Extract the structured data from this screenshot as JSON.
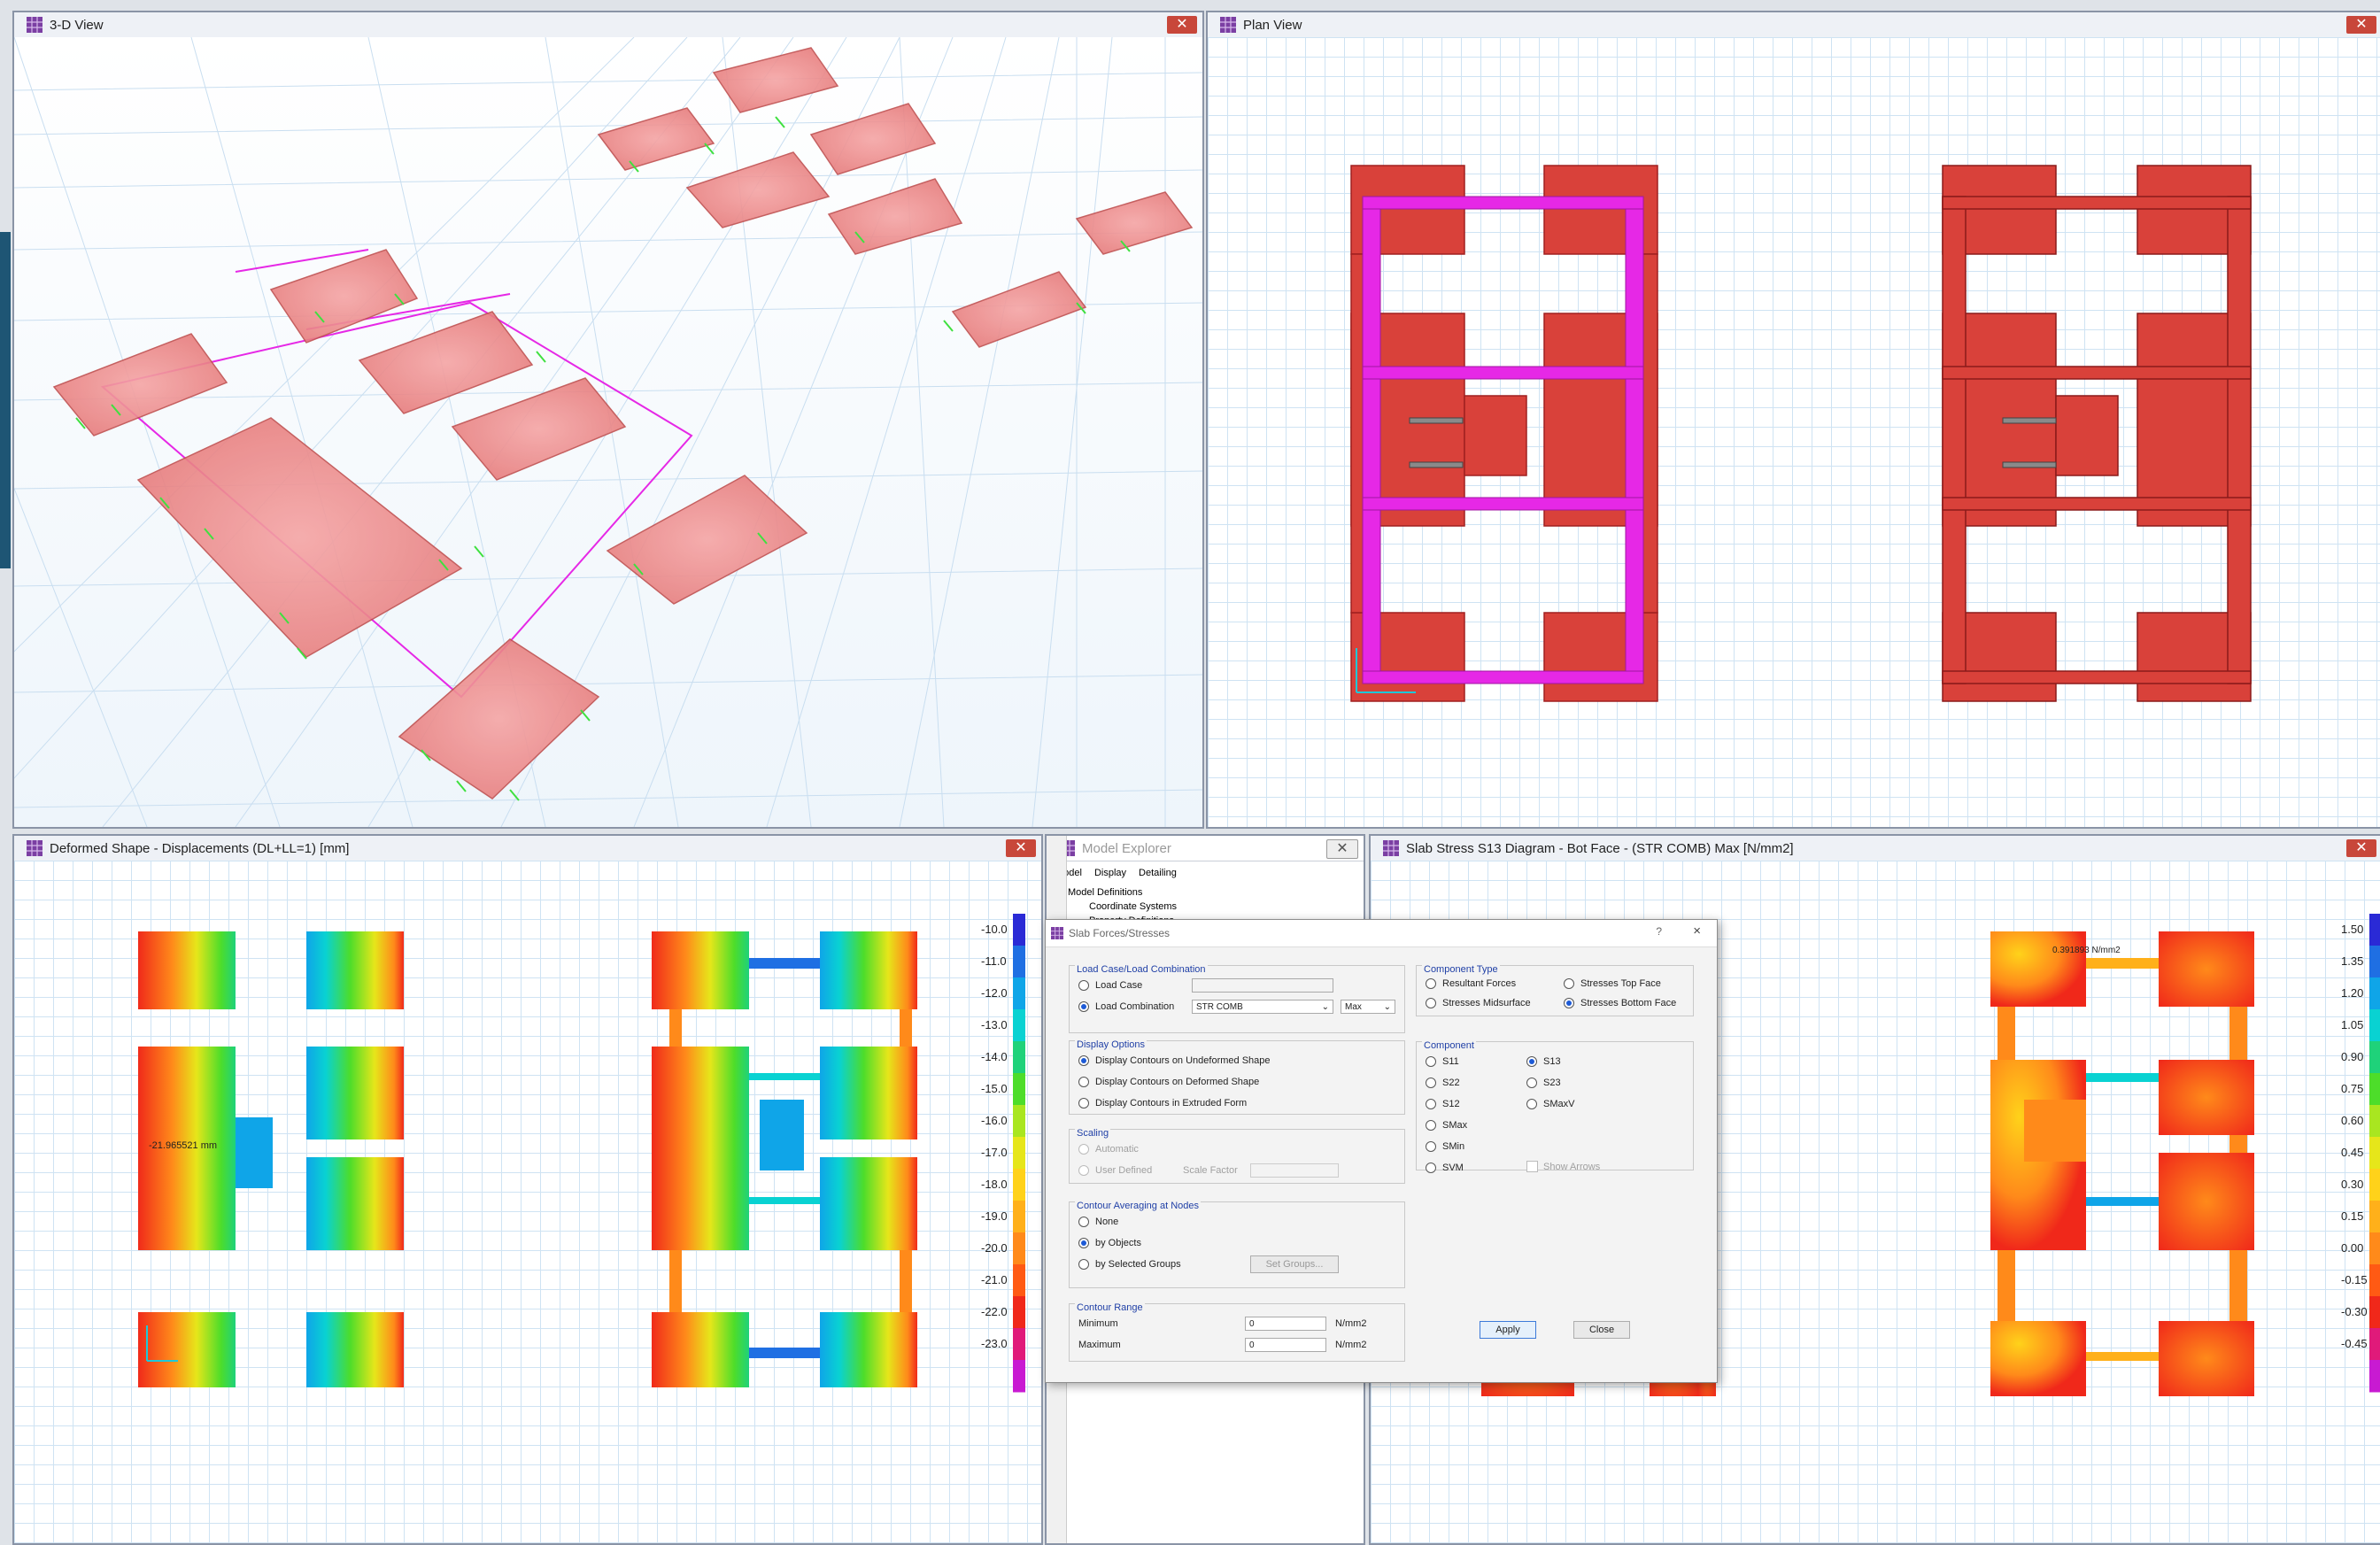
{
  "windows": {
    "view3d": {
      "title": "3-D View"
    },
    "plan": {
      "title": "Plan View"
    },
    "deformed": {
      "title": "Deformed Shape - Displacements (DL+LL=1)  [mm]",
      "annotation": "-21.965521 mm",
      "legend": [
        "-10.0",
        "-11.0",
        "-12.0",
        "-13.0",
        "-14.0",
        "-15.0",
        "-16.0",
        "-17.0",
        "-18.0",
        "-19.0",
        "-20.0",
        "-21.0",
        "-22.0",
        "-23.0"
      ],
      "legend_colors": [
        "#2a2ad6",
        "#1f6fe3",
        "#0fa5e8",
        "#09d2d2",
        "#1fd27a",
        "#4ddd2a",
        "#a9e620",
        "#e6e61a",
        "#ffd21a",
        "#ffb01a",
        "#ff8a1a",
        "#ff5a14",
        "#f0281a",
        "#e01a7a",
        "#c81ad2"
      ]
    },
    "slab_stress": {
      "title": "Slab Stress S13 Diagram - Bot Face - (STR COMB)  Max  [N/mm2]",
      "annotation": "0.391893 N/mm2",
      "legend": [
        "1.50",
        "1.35",
        "1.20",
        "1.05",
        "0.90",
        "0.75",
        "0.60",
        "0.45",
        "0.30",
        "0.15",
        "0.00",
        "-0.15",
        "-0.30",
        "-0.45"
      ],
      "legend_colors": [
        "#2a2ad6",
        "#1f6fe3",
        "#0fa5e8",
        "#09d2d2",
        "#1fd27a",
        "#4ddd2a",
        "#a9e620",
        "#e6e61a",
        "#ffd21a",
        "#ffb01a",
        "#ff8a1a",
        "#ff5a14",
        "#f0281a",
        "#e01a7a",
        "#c81ad2"
      ]
    }
  },
  "model_explorer": {
    "title": "Model Explorer",
    "tabs": [
      "Model",
      "Display",
      "Detailing"
    ],
    "tree": [
      "Model Definitions",
      "Coordinate Systems",
      "Property Definitions"
    ]
  },
  "dialog": {
    "title": "Slab Forces/Stresses",
    "help": "?",
    "close": "×",
    "load_group": {
      "title": "Load Case/Load Combination",
      "load_case": "Load Case",
      "load_combination": "Load Combination",
      "combo_value": "STR COMB",
      "max_value": "Max"
    },
    "display_options": {
      "title": "Display Options",
      "items": [
        "Display Contours on Undeformed Shape",
        "Display Contours on Deformed Shape",
        "Display Contours in Extruded Form"
      ]
    },
    "scaling": {
      "title": "Scaling",
      "automatic": "Automatic",
      "user_defined": "User Defined",
      "scale_factor": "Scale Factor"
    },
    "averaging": {
      "title": "Contour Averaging at Nodes",
      "items": [
        "None",
        "by Objects",
        "by Selected Groups"
      ],
      "set_groups": "Set Groups..."
    },
    "range": {
      "title": "Contour Range",
      "minimum": "Minimum",
      "maximum": "Maximum",
      "min_value": "0",
      "max_value": "0",
      "unit": "N/mm2"
    },
    "component_type": {
      "title": "Component Type",
      "items": [
        "Resultant Forces",
        "Stresses Top Face",
        "Stresses Midsurface",
        "Stresses Bottom Face"
      ]
    },
    "component": {
      "title": "Component",
      "left": [
        "S11",
        "S22",
        "S12",
        "SMax",
        "SMin",
        "SVM"
      ],
      "right": [
        "S13",
        "S23",
        "SMaxV"
      ],
      "show_arrows": "Show Arrows"
    },
    "apply": "Apply",
    "close_btn": "Close"
  },
  "colors": {
    "frame_magenta": "#e628e6",
    "slab_red": "#d9413a",
    "grid": "#cfe3f3"
  }
}
